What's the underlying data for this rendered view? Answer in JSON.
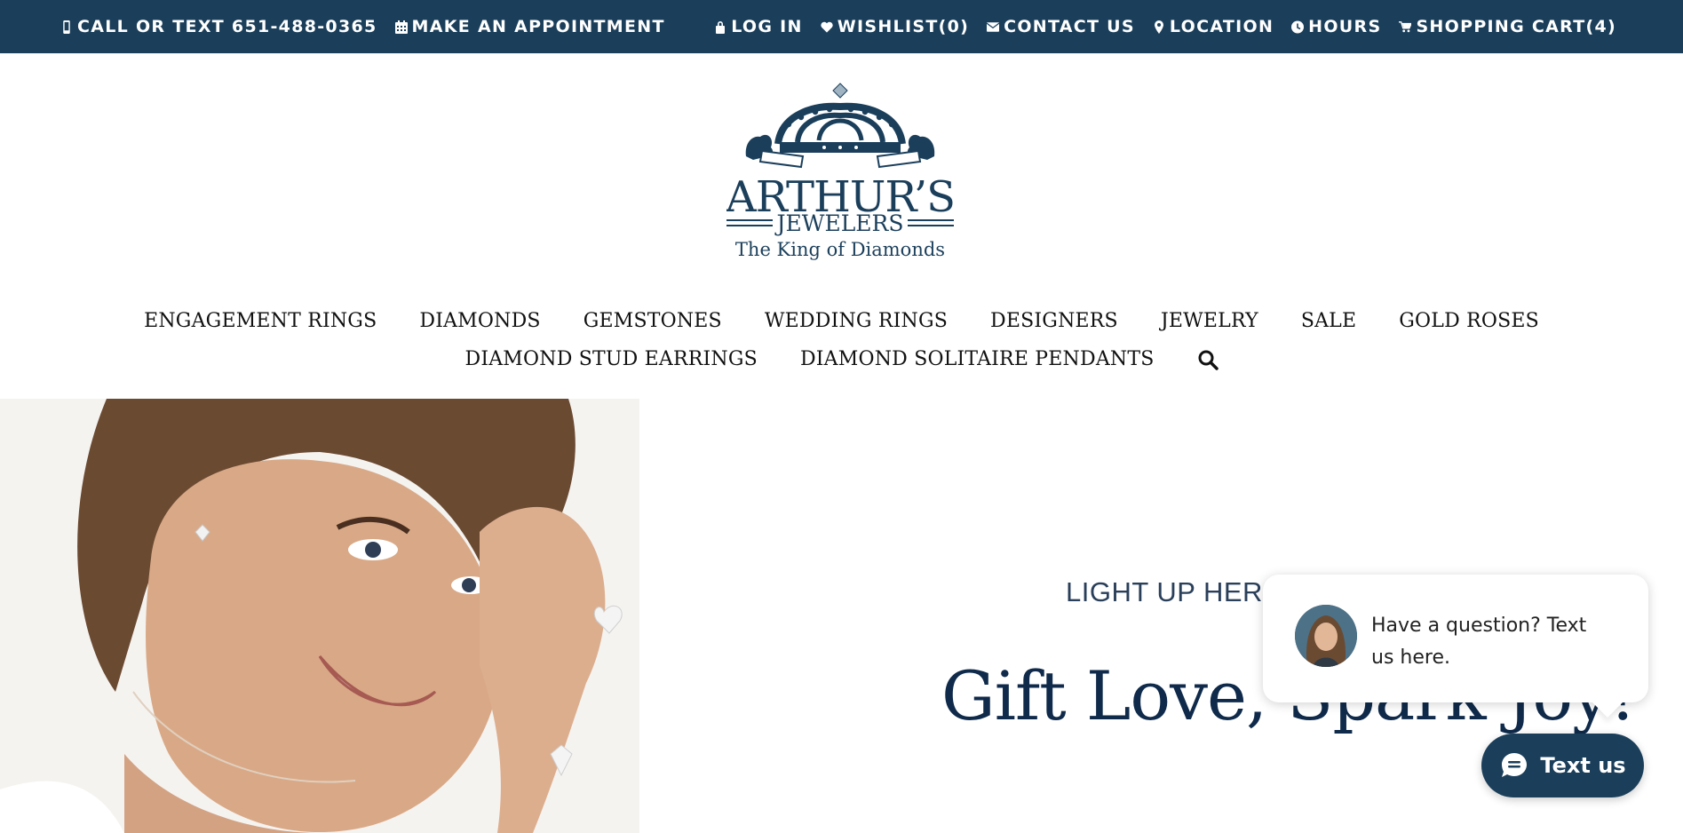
{
  "topbar": {
    "left": [
      {
        "icon": "mobile-phone-icon",
        "label": "CALL OR TEXT 651-488-0365"
      },
      {
        "icon": "calendar-icon",
        "label": "MAKE AN APPOINTMENT"
      }
    ],
    "right": [
      {
        "icon": "lock-icon",
        "label": "LOG IN"
      },
      {
        "icon": "heart-icon",
        "label": "WISHLIST(0)"
      },
      {
        "icon": "envelope-icon",
        "label": "CONTACT US"
      },
      {
        "icon": "map-pin-icon",
        "label": "LOCATION"
      },
      {
        "icon": "clock-icon",
        "label": "HOURS"
      },
      {
        "icon": "shopping-cart-icon",
        "label": "SHOPPING CART(4)"
      }
    ],
    "background": "#1b3f5b"
  },
  "logo": {
    "name": "ARTHUR'S",
    "sub": "JEWELERS",
    "tagline": "The King of Diamonds"
  },
  "nav": {
    "row1": [
      "ENGAGEMENT RINGS",
      "DIAMONDS",
      "GEMSTONES",
      "WEDDING RINGS",
      "DESIGNERS",
      "JEWELRY",
      "SALE",
      "GOLD ROSES"
    ],
    "row2": [
      "DIAMOND STUD EARRINGS",
      "DIAMOND SOLITAIRE PENDANTS"
    ],
    "search_icon": "search-icon"
  },
  "hero": {
    "kicker": "LIGHT UP HER W",
    "headline": "Gift Love, Spark Joy!"
  },
  "chat": {
    "message": "Have a question? Text us here.",
    "button_label": "Text us",
    "accent": "#1b3f5b"
  }
}
